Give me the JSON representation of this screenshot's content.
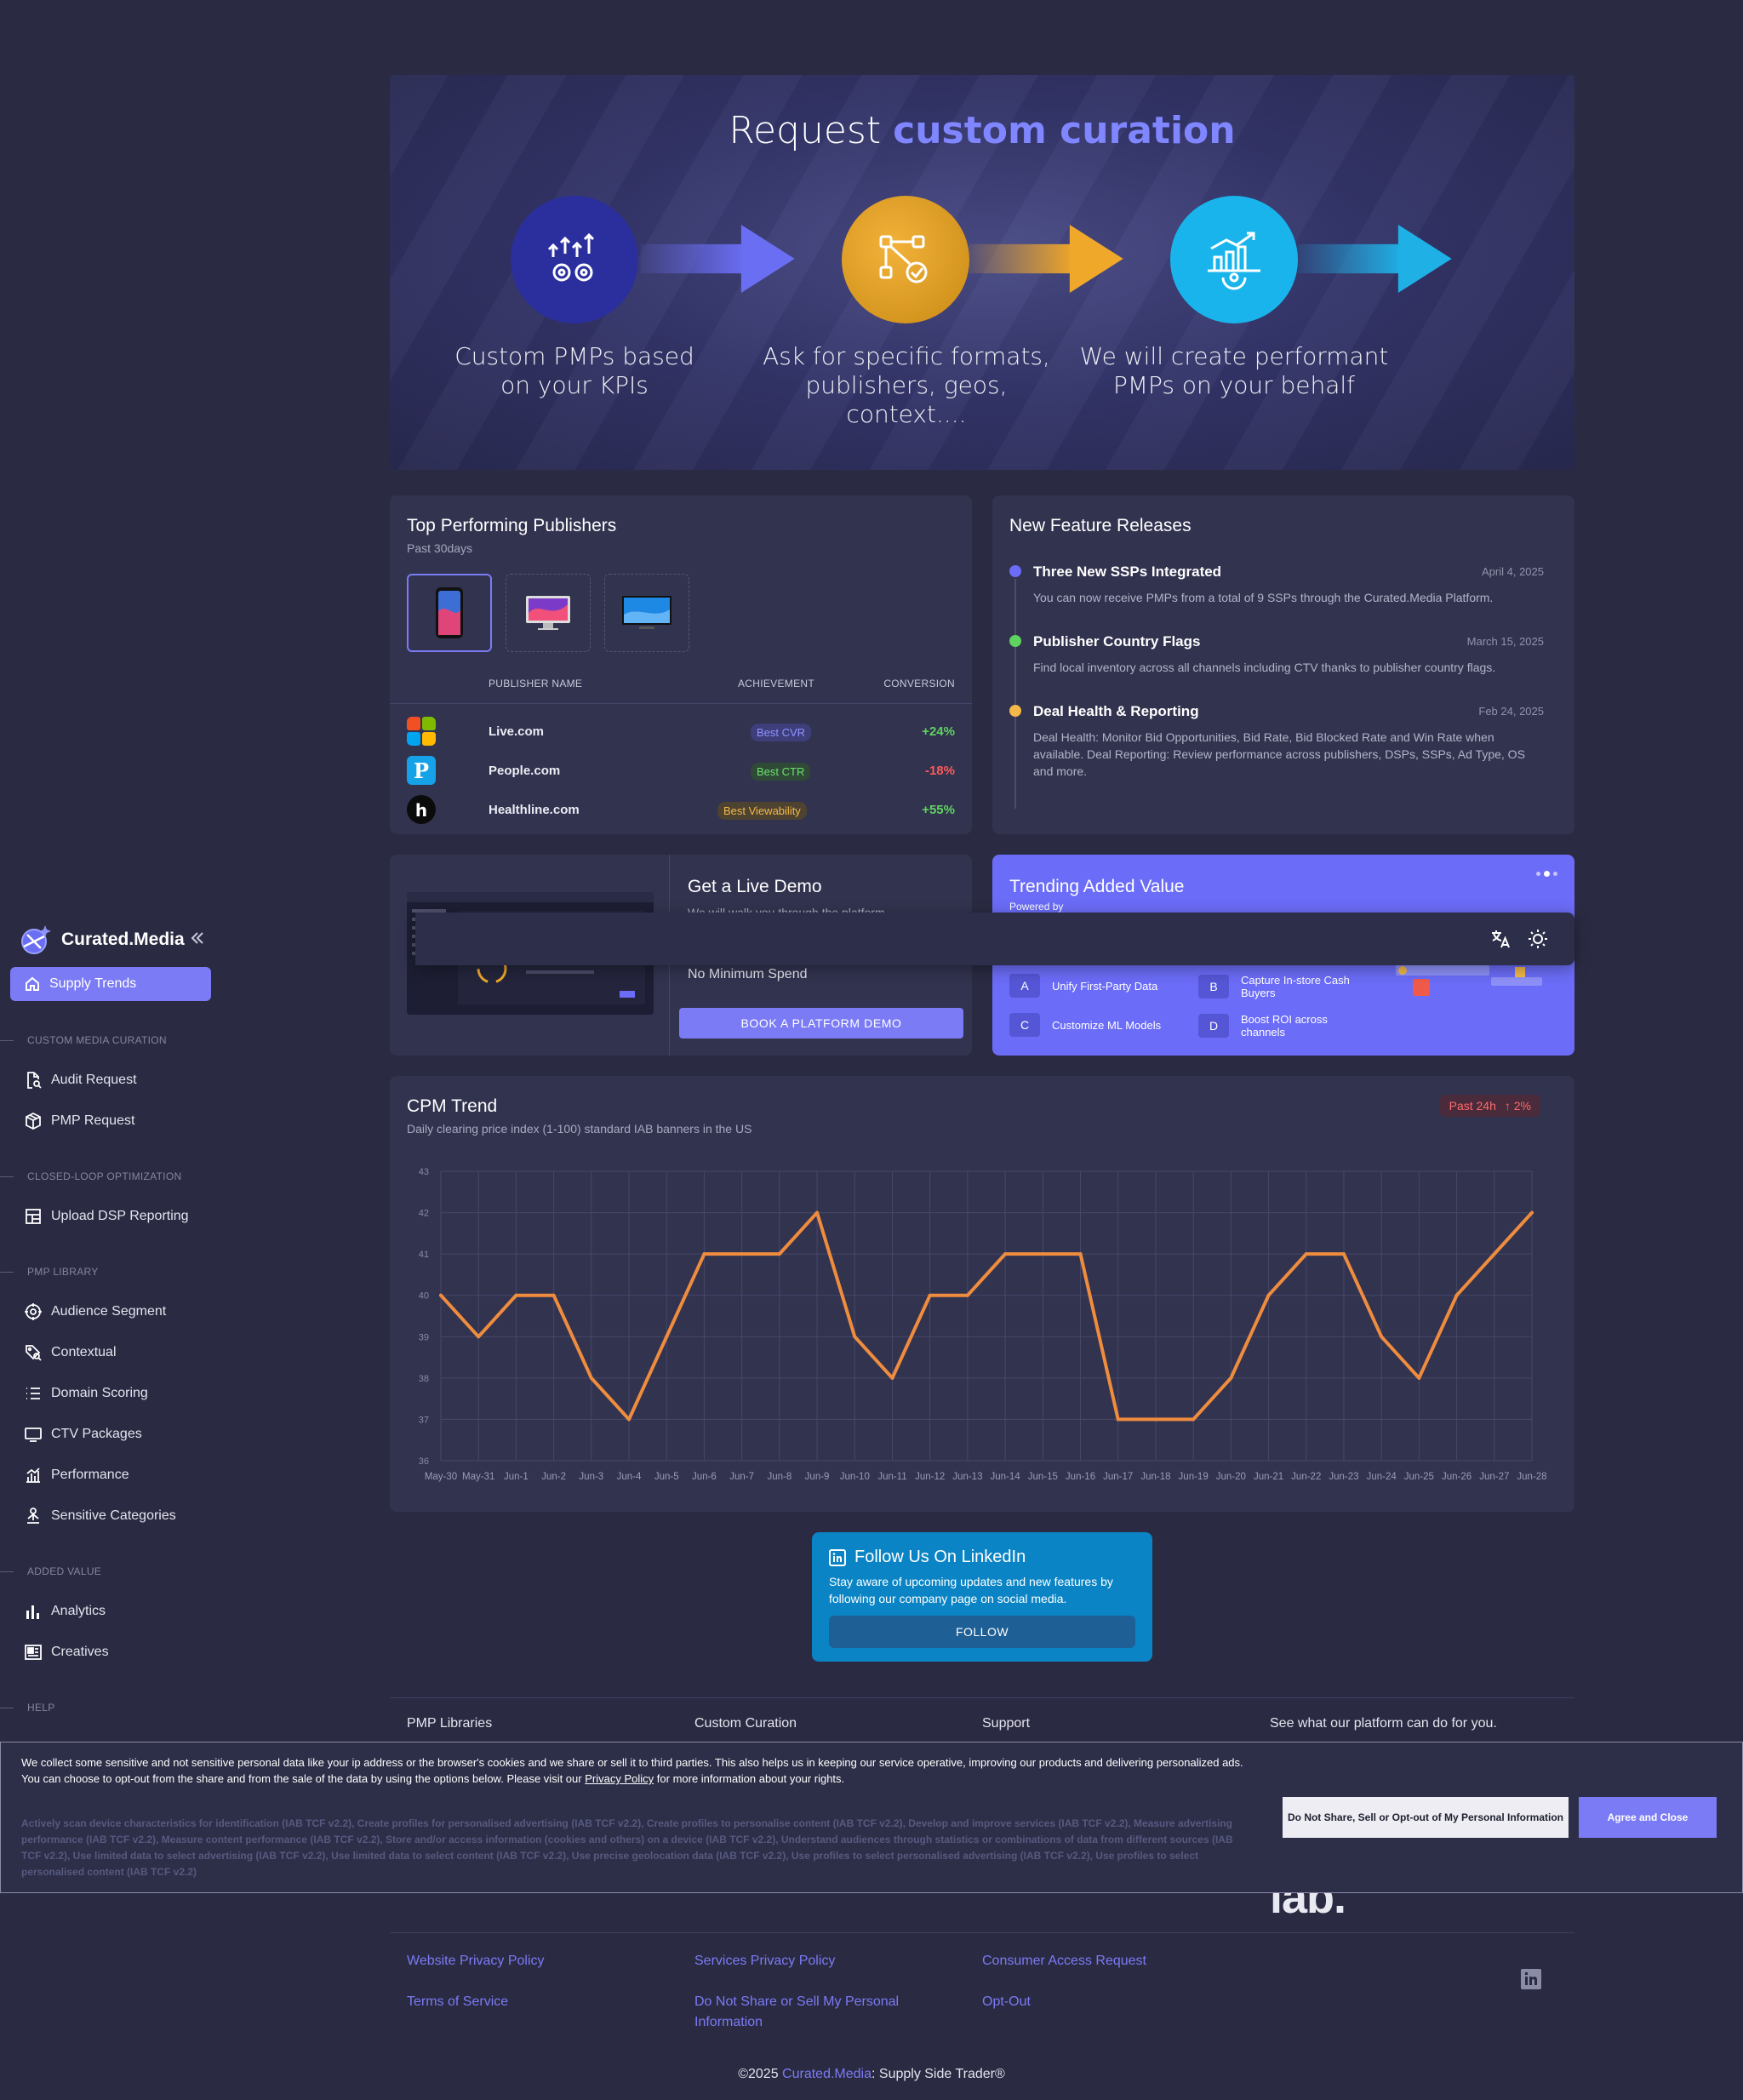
{
  "sidebar": {
    "brand": "Curated.Media",
    "active_item": "Supply Trends",
    "sections": [
      {
        "title": "CUSTOM MEDIA CURATION",
        "items": [
          "Audit Request",
          "PMP Request"
        ]
      },
      {
        "title": "CLOSED-LOOP OPTIMIZATION",
        "items": [
          "Upload DSP Reporting"
        ]
      },
      {
        "title": "PMP LIBRARY",
        "items": [
          "Audience Segment",
          "Contextual",
          "Domain Scoring",
          "CTV Packages",
          "Performance",
          "Sensitive Categories"
        ]
      },
      {
        "title": "ADDED VALUE",
        "items": [
          "Analytics",
          "Creatives"
        ]
      },
      {
        "title": "HELP",
        "items": []
      }
    ]
  },
  "banner": {
    "title_plain": "Request",
    "title_bold": "custom curation",
    "steps": [
      {
        "line1": "Custom PMPs based",
        "line2": "on your KPIs",
        "color": "#2b2f9e",
        "arrow": "#6a6ef2"
      },
      {
        "line1": "Ask for specific formats,",
        "line2": "publishers, geos, context....",
        "color": "#e2a020",
        "arrow": "#f0a82a"
      },
      {
        "line1": "We will create performant",
        "line2": "PMPs on your behalf",
        "color": "#19b4ec",
        "arrow": "#1fb0e6"
      }
    ]
  },
  "publishers": {
    "title": "Top Performing Publishers",
    "subtitle": "Past 30days",
    "headers": {
      "name": "PUBLISHER NAME",
      "achievement": "ACHIEVEMENT",
      "conversion": "CONVERSION"
    },
    "rows": [
      {
        "name": "Live.com",
        "achievement": "Best CVR",
        "conversion": "+24%",
        "badge_bg": "#3e3f7a",
        "badge_fg": "#8f92ff",
        "conv_color": "#5fd35f"
      },
      {
        "name": "People.com",
        "achievement": "Best CTR",
        "conversion": "-18%",
        "badge_bg": "#2f4a36",
        "badge_fg": "#6fe06f",
        "conv_color": "#ff5a5a"
      },
      {
        "name": "Healthline.com",
        "achievement": "Best Viewability",
        "conversion": "+55%",
        "badge_bg": "#4e4330",
        "badge_fg": "#f3b84a",
        "conv_color": "#5fd35f"
      }
    ]
  },
  "features": {
    "title": "New Feature Releases",
    "items": [
      {
        "name": "Three New SSPs Integrated",
        "date": "April 4, 2025",
        "desc": "You can now receive PMPs from a total of 9 SSPs through the Curated.Media Platform.",
        "color": "#6b6cf7"
      },
      {
        "name": "Publisher Country Flags",
        "date": "March 15, 2025",
        "desc": "Find local inventory across all channels including CTV thanks to publisher country flags.",
        "color": "#5fd35f"
      },
      {
        "name": "Deal Health & Reporting",
        "date": "Feb 24, 2025",
        "desc": "Deal Health: Monitor Bid Opportunities, Bid Rate, Bid Blocked Rate and Win Rate when available. Deal Reporting: Review performance across publishers, DSPs, SSPs, Ad Type, OS and more.",
        "color": "#f3b84a"
      }
    ]
  },
  "demo": {
    "title": "Get a Live Demo",
    "subtitle": "We will walk you through the platform",
    "min_spend": "No Minimum Spend",
    "button": "BOOK A PLATFORM DEMO"
  },
  "trending": {
    "title": "Trending Added Value",
    "powered": "Powered by",
    "items": [
      {
        "letter": "A",
        "text": "Unify First-Party Data"
      },
      {
        "letter": "B",
        "text": "Capture In-store Cash Buyers"
      },
      {
        "letter": "C",
        "text": "Customize ML Models"
      },
      {
        "letter": "D",
        "text": "Boost ROI across channels"
      }
    ]
  },
  "cpm": {
    "title": "CPM Trend",
    "subtitle": "Daily clearing price index (1-100) standard IAB banners in the US",
    "badge_period": "Past 24h",
    "badge_change": "↑ 2%"
  },
  "chart_data": {
    "type": "line",
    "x": [
      "May-30",
      "May-31",
      "Jun-1",
      "Jun-2",
      "Jun-3",
      "Jun-4",
      "Jun-5",
      "Jun-6",
      "Jun-7",
      "Jun-8",
      "Jun-9",
      "Jun-10",
      "Jun-11",
      "Jun-12",
      "Jun-13",
      "Jun-14",
      "Jun-15",
      "Jun-16",
      "Jun-17",
      "Jun-18",
      "Jun-19",
      "Jun-20",
      "Jun-21",
      "Jun-22",
      "Jun-23",
      "Jun-24",
      "Jun-25",
      "Jun-26",
      "Jun-27",
      "Jun-28"
    ],
    "series": [
      {
        "values": [
          40,
          39,
          40,
          40,
          38,
          37,
          39,
          41,
          41,
          41,
          42,
          39,
          38,
          40,
          40,
          41,
          41,
          41,
          37,
          37,
          37,
          38,
          40,
          41,
          41,
          39,
          38,
          40,
          41,
          42
        ],
        "color": "#ef8c3e"
      }
    ],
    "ylim": [
      36,
      43
    ],
    "yticks": [
      36,
      37,
      38,
      39,
      40,
      41,
      42,
      43
    ],
    "grid": true
  },
  "linkedin": {
    "title": "Follow Us On LinkedIn",
    "text": "Stay aware of upcoming updates and new features by following our company page on social media.",
    "button": "FOLLOW"
  },
  "footer": {
    "columns": [
      "PMP Libraries",
      "Custom Curation",
      "Support",
      "See what our platform can do for you."
    ],
    "links": {
      "col1": [
        "Website Privacy Policy",
        "Terms of Service"
      ],
      "col2": [
        "Services Privacy Policy",
        "Do Not Share or Sell My Personal Information"
      ],
      "col3": [
        "Consumer Access Request",
        "Opt-Out"
      ]
    },
    "iab": "iab.",
    "copyright_pre": "©2025 ",
    "copyright_brand": "Curated.Media",
    "copyright_post": ": Supply Side Trader®"
  },
  "consent": {
    "text1": "We collect some sensitive and not sensitive personal data like your ip address or the browser's cookies and we share or sell it to third parties. This also helps us in keeping our service operative, improving our products and delivering personalized ads.",
    "text2": "You can choose to opt-out from the share and from the sale of the data by using the options below. Please visit our",
    "link": "Privacy Policy",
    "text3": "for more information about your rights.",
    "purposes": "Actively scan device characteristics for identification (IAB TCF v2.2), Create profiles for personalised advertising (IAB TCF v2.2), Create profiles to personalise content (IAB TCF v2.2), Develop and improve services (IAB TCF v2.2), Measure advertising performance (IAB TCF v2.2), Measure content performance (IAB TCF v2.2), Store and/or access information (cookies and others) on a device (IAB TCF v2.2), Understand audiences through statistics or combinations of data from different sources (IAB TCF v2.2), Use limited data to select advertising (IAB TCF v2.2), Use limited data to select content (IAB TCF v2.2), Use precise geolocation data (IAB TCF v2.2), Use profiles to select personalised advertising (IAB TCF v2.2), Use profiles to select personalised content (IAB TCF v2.2)",
    "btn_optout": "Do Not Share, Sell or Opt-out of My Personal Information",
    "btn_agree": "Agree and Close"
  }
}
